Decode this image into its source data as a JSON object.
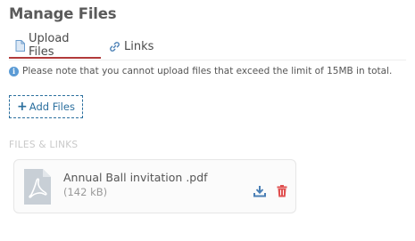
{
  "header": {
    "title": "Manage Files"
  },
  "tabs": [
    {
      "label": "Upload Files",
      "icon": "file-icon",
      "active": true
    },
    {
      "label": "Links",
      "icon": "link-icon",
      "active": false
    }
  ],
  "note": {
    "icon": "info-icon",
    "text": "Please note that you cannot upload files that exceed the limit of 15MB in total."
  },
  "add_button": {
    "label": "Add Files",
    "icon": "plus-icon"
  },
  "section": {
    "label": "FILES & LINKS"
  },
  "files": [
    {
      "name": "Annual Ball invitation .pdf",
      "size": "(142 kB)",
      "icon": "pdf-file-icon"
    }
  ],
  "colors": {
    "accent_tab": "#b23a3a",
    "link_blue": "#2b6f9e",
    "delete_red": "#e05050",
    "info_blue": "#5b9bd5"
  }
}
